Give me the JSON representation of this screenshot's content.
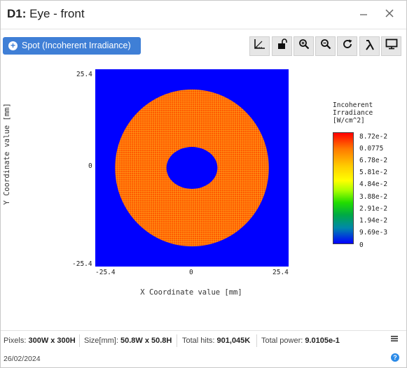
{
  "window": {
    "title_prefix": "D1:",
    "title_rest": " Eye - front",
    "minimize_icon": "minimize-icon",
    "close_icon": "close-icon"
  },
  "spot_button": {
    "label": "Spot (Incoherent Irradiance)",
    "icon": "plus-circle-icon"
  },
  "toolbar": [
    {
      "icon": "measure-icon",
      "name": "measure-button"
    },
    {
      "icon": "unlock-icon",
      "name": "lock-button"
    },
    {
      "icon": "zoom-in-icon",
      "name": "zoom-in-button"
    },
    {
      "icon": "zoom-out-icon",
      "name": "zoom-out-button"
    },
    {
      "icon": "refresh-icon",
      "name": "refresh-button"
    },
    {
      "icon": "lambda-icon",
      "name": "wavelength-button"
    },
    {
      "icon": "monitor-icon",
      "name": "display-button"
    }
  ],
  "chart_data": {
    "type": "heatmap",
    "title": "",
    "xlabel": "X Coordinate value [mm]",
    "ylabel": "Y Coordinate value [mm]",
    "xlim": [
      -25.4,
      25.4
    ],
    "ylim": [
      -25.4,
      25.4
    ],
    "x_ticks": [
      "-25.4",
      "0",
      "25.4"
    ],
    "y_ticks": [
      "25.4",
      "0",
      "-25.4"
    ],
    "annulus": {
      "outer_radius_mm": 20.2,
      "inner_radius_x_mm": 6.7,
      "inner_radius_y_mm": 5.4,
      "center": [
        0,
        0
      ],
      "value": 0.0775
    },
    "background_value": 0,
    "colorbar": {
      "title_lines": [
        "Incoherent",
        "Irradiance",
        "[W/cm^2]"
      ],
      "ticks": [
        "8.72e-2",
        "0.0775",
        "6.78e-2",
        "5.81e-2",
        "4.84e-2",
        "3.88e-2",
        "2.91e-2",
        "1.94e-2",
        "9.69e-3",
        "0"
      ],
      "min": 0,
      "max": 0.0872
    },
    "colors": {
      "background": "#0000ff",
      "ring": "#ff5a00",
      "ring_grid": "#ffcc33"
    }
  },
  "status": {
    "pixels_label": "Pixels:",
    "pixels_value": "300W x 300H",
    "size_label": "Size[mm]:",
    "size_value": "50.8W x 50.8H",
    "hits_label": "Total hits:",
    "hits_value": "901,045K",
    "power_label": "Total power:",
    "power_value": "9.0105e-1",
    "date": "26/02/2024",
    "menu_icon": "hamburger-menu-icon",
    "help_icon": "help-icon"
  }
}
